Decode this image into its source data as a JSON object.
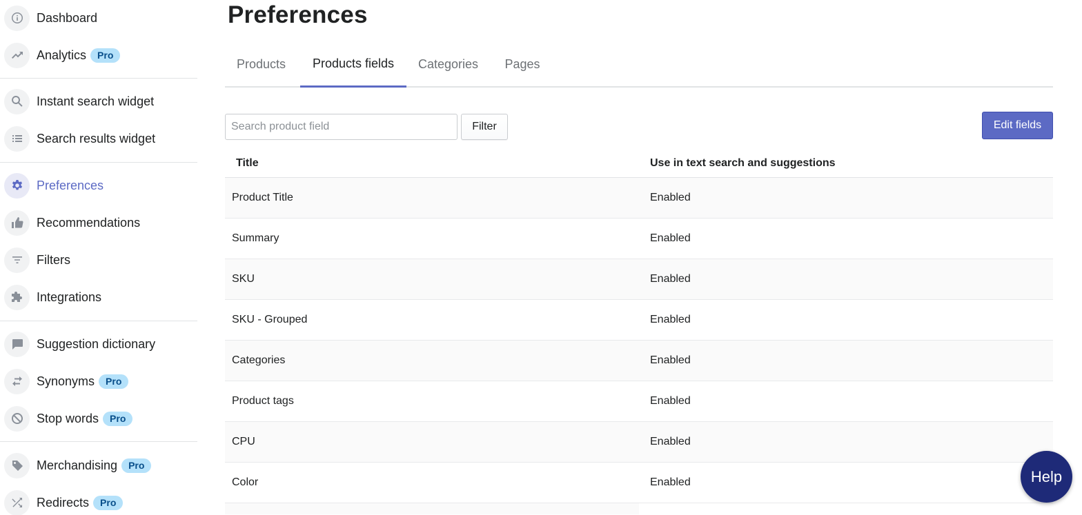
{
  "sidebar": {
    "items": [
      {
        "label": "Dashboard",
        "icon": "info-icon",
        "badge": ""
      },
      {
        "label": "Analytics",
        "icon": "trending-up-icon",
        "badge": "Pro"
      },
      {
        "label": "Instant search widget",
        "icon": "search-icon",
        "badge": ""
      },
      {
        "label": "Search results widget",
        "icon": "list-icon",
        "badge": ""
      },
      {
        "label": "Preferences",
        "icon": "gear-icon",
        "badge": "",
        "active": true
      },
      {
        "label": "Recommendations",
        "icon": "thumbs-up-icon",
        "badge": ""
      },
      {
        "label": "Filters",
        "icon": "filter-icon",
        "badge": ""
      },
      {
        "label": "Integrations",
        "icon": "puzzle-icon",
        "badge": ""
      },
      {
        "label": "Suggestion dictionary",
        "icon": "chat-icon",
        "badge": ""
      },
      {
        "label": "Synonyms",
        "icon": "swap-icon",
        "badge": "Pro"
      },
      {
        "label": "Stop words",
        "icon": "block-icon",
        "badge": "Pro"
      },
      {
        "label": "Merchandising",
        "icon": "tag-icon",
        "badge": "Pro"
      },
      {
        "label": "Redirects",
        "icon": "shuffle-icon",
        "badge": "Pro"
      }
    ]
  },
  "page": {
    "title": "Preferences"
  },
  "tabs": [
    {
      "label": "Products"
    },
    {
      "label": "Products fields",
      "active": true
    },
    {
      "label": "Categories"
    },
    {
      "label": "Pages"
    }
  ],
  "toolbar": {
    "search_placeholder": "Search product field",
    "search_value": "",
    "filter_label": "Filter",
    "edit_label": "Edit fields"
  },
  "table": {
    "headers": {
      "title": "Title",
      "use": "Use in text search and suggestions"
    },
    "rows": [
      {
        "title": "Product Title",
        "use": "Enabled"
      },
      {
        "title": "Summary",
        "use": "Enabled"
      },
      {
        "title": "SKU",
        "use": "Enabled"
      },
      {
        "title": "SKU - Grouped",
        "use": "Enabled"
      },
      {
        "title": "Categories",
        "use": "Enabled"
      },
      {
        "title": "Product tags",
        "use": "Enabled"
      },
      {
        "title": "CPU",
        "use": "Enabled"
      },
      {
        "title": "Color",
        "use": "Enabled"
      }
    ]
  },
  "help": {
    "label": "Help"
  },
  "colors": {
    "accent": "#5c6ac4",
    "badge_bg": "#b4e1fa",
    "help_bg": "#1e2a78"
  }
}
